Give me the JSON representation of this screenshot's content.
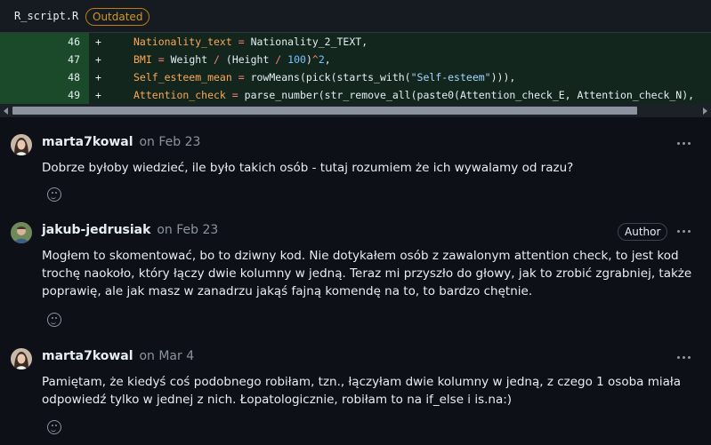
{
  "file": {
    "name": "R_script.R",
    "badge": "Outdated"
  },
  "code_lines": [
    {
      "num": "46",
      "sign": "+",
      "text": "Nationality_text = Nationality_2_TEXT,"
    },
    {
      "num": "47",
      "sign": "+",
      "text": "BMI = Weight / (Height / 100)^2,"
    },
    {
      "num": "48",
      "sign": "+",
      "text": "Self_esteem_mean = rowMeans(pick(starts_with(\"Self-esteem\"))),"
    },
    {
      "num": "49",
      "sign": "+",
      "text": "Attention_check = parse_number(str_remove_all(paste0(Attention_check_E, Attention_check_N),"
    }
  ],
  "comments": [
    {
      "author": "marta7kowal",
      "date": "on Feb 23",
      "badge": "",
      "body": "Dobrze byłoby wiedzieć, ile było takich osób - tutaj rozumiem że ich wywalamy od razu?"
    },
    {
      "author": "jakub-jedrusiak",
      "date": "on Feb 23",
      "badge": "Author",
      "body": "Mogłem to skomentować, bo to dziwny kod. Nie dotykałem osób z zawalonym attention check, to jest kod trochę naokoło, który łączy dwie kolumny w jedną. Teraz mi przyszło do głowy, jak to zrobić zgrabniej, także poprawię, ale jak masz w zanadrzu jakąś fajną komendę na to, to bardzo chętnie."
    },
    {
      "author": "marta7kowal",
      "date": "on Mar 4",
      "badge": "",
      "body": "Pamiętam, że kiedyś coś podobnego robiłam, tzn., łączyłam dwie kolumny w jedną, z czego 1 osoba miała odpowiedź tylko w jednej z nich. Łopatologicznie, robiłam to na if_else i is.na:)"
    }
  ],
  "icons": {
    "more": "kebab-horizontal-icon",
    "reaction": "smiley-icon"
  }
}
